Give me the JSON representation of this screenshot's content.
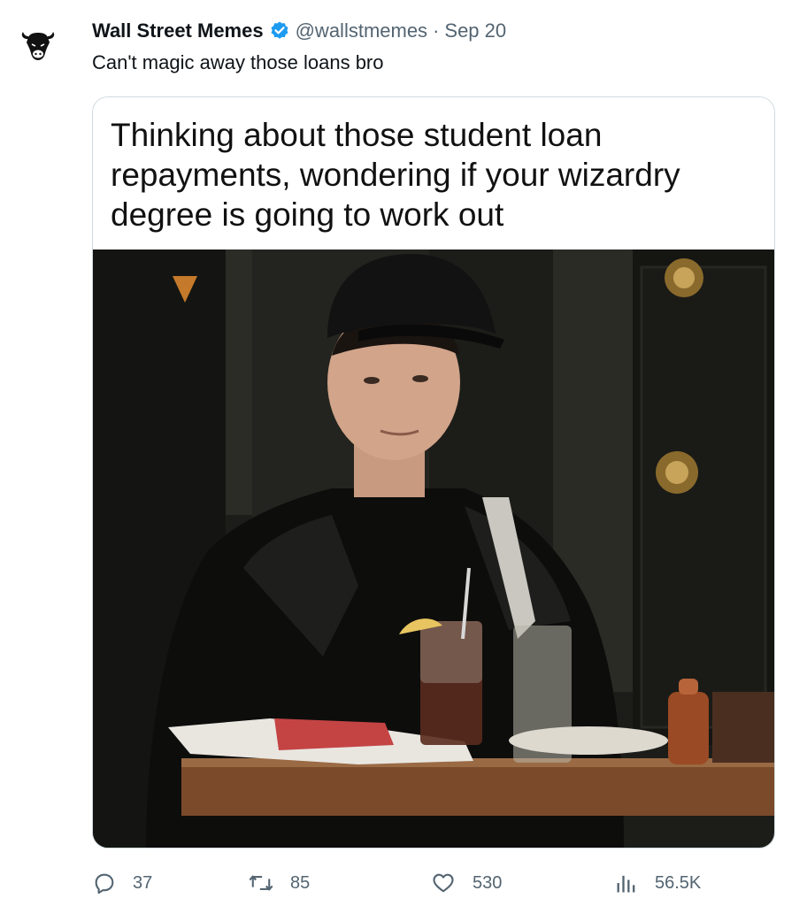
{
  "tweet": {
    "author_name": "Wall Street Memes",
    "handle": "@wallstmemes",
    "separator": "·",
    "date": "Sep 20",
    "text": "Can't magic away those loans bro"
  },
  "media": {
    "caption_lines": [
      "Thinking about those student loan",
      "repayments, wondering if your wizardry",
      "degree is going to work out"
    ]
  },
  "actions": {
    "replies": "37",
    "retweets": "85",
    "likes": "530",
    "views": "56.5K"
  },
  "icons": {
    "verified": "verified-badge-icon",
    "reply": "reply-icon",
    "retweet": "retweet-icon",
    "like": "heart-icon",
    "views": "views-chart-icon"
  },
  "colors": {
    "verified": "#1d9bf0",
    "secondary_text": "#536471",
    "primary_text": "#0f1419",
    "border": "#cfd9de"
  }
}
